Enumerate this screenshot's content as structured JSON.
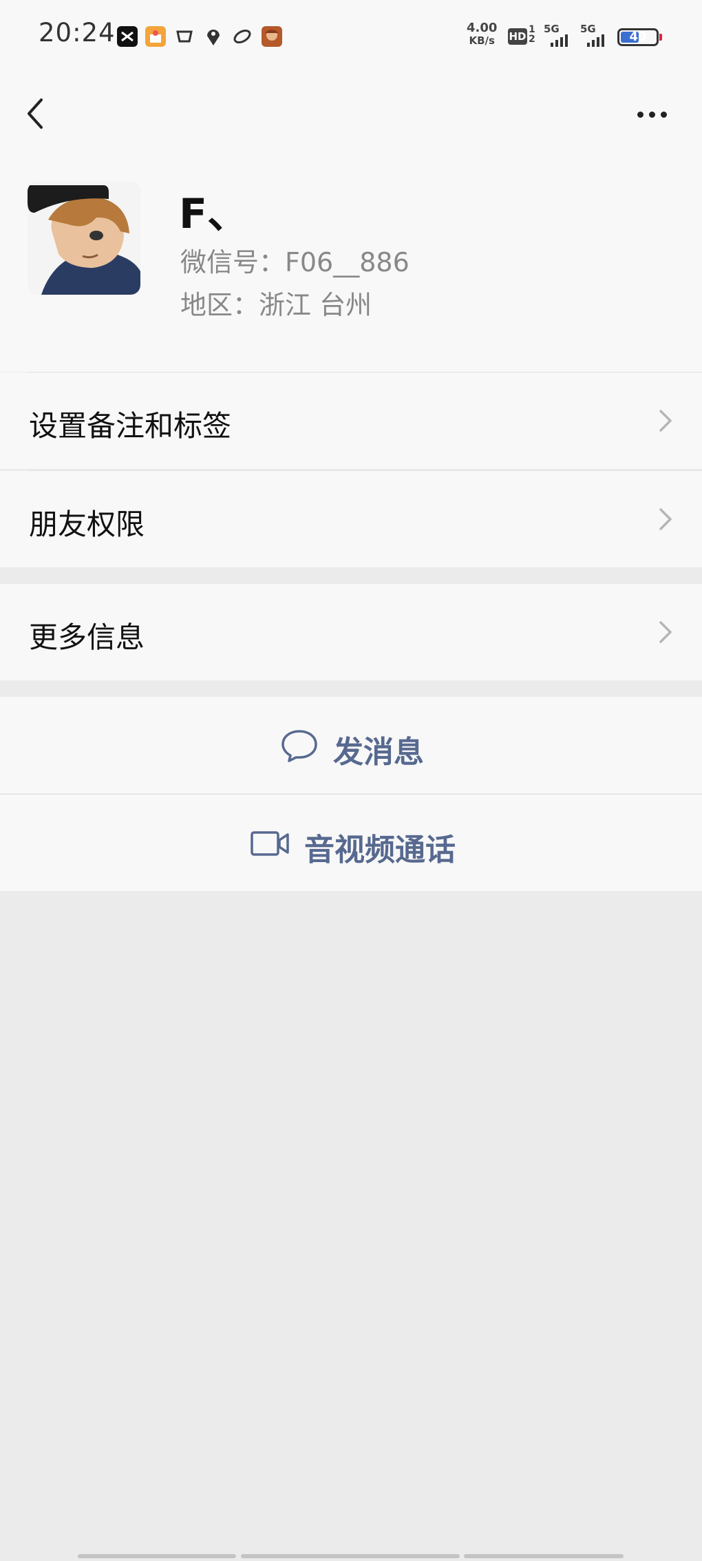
{
  "status_bar": {
    "time": "20:24",
    "net_speed_value": "4.00",
    "net_speed_unit": "KB/s",
    "hd_label": "HD",
    "hd_sub": "1 2",
    "sim1_label": "5G",
    "sim2_label": "5G",
    "battery_level": "49",
    "icons": [
      "capcut-icon",
      "game-app-icon",
      "cup-icon",
      "location-pin-icon",
      "link-icon",
      "game-avatar-icon"
    ]
  },
  "nav": {
    "back_icon": "chevron-left-icon",
    "more_icon": "more-dots-icon"
  },
  "profile": {
    "name": "F、",
    "wechat_id": "微信号：F06__886",
    "region": "地区：浙江  台州"
  },
  "menu": {
    "remarks_tags": "设置备注和标签",
    "friend_permissions": "朋友权限",
    "more_info": "更多信息"
  },
  "actions": {
    "send_message": "发消息",
    "video_call": "音视频通话"
  },
  "colors": {
    "background": "#ebebeb",
    "card": "#f8f8f8",
    "action_text": "#57698f",
    "battery": "#3a6fd0"
  }
}
